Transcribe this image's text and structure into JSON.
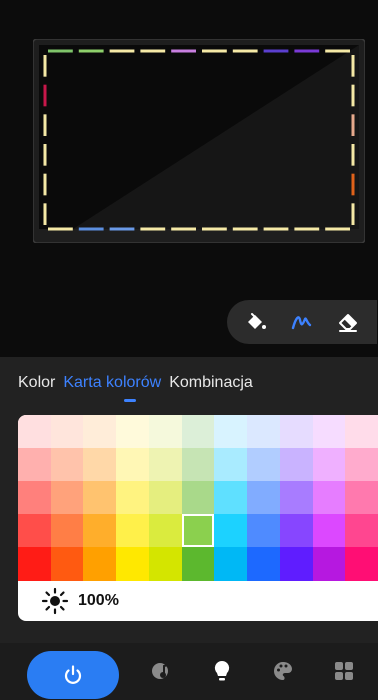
{
  "tv_preview": {
    "top_segments": [
      "#7fc46a",
      "#8ed06b",
      "#f5e9a6",
      "#f5e9a6",
      "#c87fe0",
      "#f5e9a6",
      "#f5e9a6",
      "#5b3fcf",
      "#7a3ad6",
      "#f5e9a6"
    ],
    "bottom_segments": [
      "#f5e9a6",
      "#5c8fe0",
      "#6a9ae8",
      "#f5e9a6",
      "#f5e9a6",
      "#f5e9a6",
      "#f5e9a6",
      "#f5e9a6",
      "#f5e9a6",
      "#f5e9a6"
    ],
    "left_segments": [
      "#f5e9a6",
      "#c8174a",
      "#f5e9a6",
      "#f5e9a6",
      "#f5e9a6",
      "#f5e9a6"
    ],
    "right_segments": [
      "#f5e9a6",
      "#f5e9a6",
      "#e6a98c",
      "#f5e9a6",
      "#e0621a",
      "#f5e9a6"
    ]
  },
  "toolbar": {
    "tools": [
      {
        "name": "fill-bucket-icon"
      },
      {
        "name": "brush-icon",
        "active": true
      },
      {
        "name": "eraser-icon"
      }
    ]
  },
  "tabs": [
    {
      "label": "Kolor",
      "active": false
    },
    {
      "label": "Karta kolorów",
      "active": true
    },
    {
      "label": "Kombinacja",
      "active": false
    }
  ],
  "palette": {
    "rows": [
      [
        "#ffdfe0",
        "#ffe5dc",
        "#ffedd9",
        "#fffadb",
        "#f5f9dc",
        "#dcefd8",
        "#d8f3ff",
        "#dbe8ff",
        "#e6dcff",
        "#f6dcff",
        "#ffdcea"
      ],
      [
        "#ffb0ae",
        "#ffc3ab",
        "#ffd8a8",
        "#fff7b5",
        "#eef3b2",
        "#c6e4b4",
        "#a9ebff",
        "#b1cdff",
        "#c9b3ff",
        "#efb0ff",
        "#ffabcd"
      ],
      [
        "#ff807c",
        "#ffa27b",
        "#ffc36f",
        "#fff380",
        "#e5ee7f",
        "#a9d98a",
        "#5fe0ff",
        "#81acff",
        "#a87cff",
        "#e67dff",
        "#ff79ae"
      ],
      [
        "#ff4e4a",
        "#ff7e46",
        "#ffae2b",
        "#fff04a",
        "#daeb3e",
        "#86cc55",
        "#1cd2ff",
        "#4f8bff",
        "#8746ff",
        "#dc48ff",
        "#ff4690"
      ],
      [
        "#ff1c16",
        "#ff5a11",
        "#ffa000",
        "#ffe800",
        "#d4e500",
        "#5cb82e",
        "#00b8f5",
        "#1d69ff",
        "#5f1dff",
        "#b618e0",
        "#ff0e74"
      ]
    ],
    "selected": {
      "row": 3,
      "col": 5,
      "color": "#8bd04e"
    }
  },
  "brightness": {
    "icon": "sun-icon",
    "value_label": "100%"
  },
  "bottom_nav": [
    {
      "name": "power-icon"
    },
    {
      "name": "music-mode-icon"
    },
    {
      "name": "lightbulb-icon"
    },
    {
      "name": "palette-icon"
    },
    {
      "name": "grid-icon"
    }
  ],
  "colors": {
    "accent": "#2a7df3",
    "tab_active": "#3d82ff"
  }
}
